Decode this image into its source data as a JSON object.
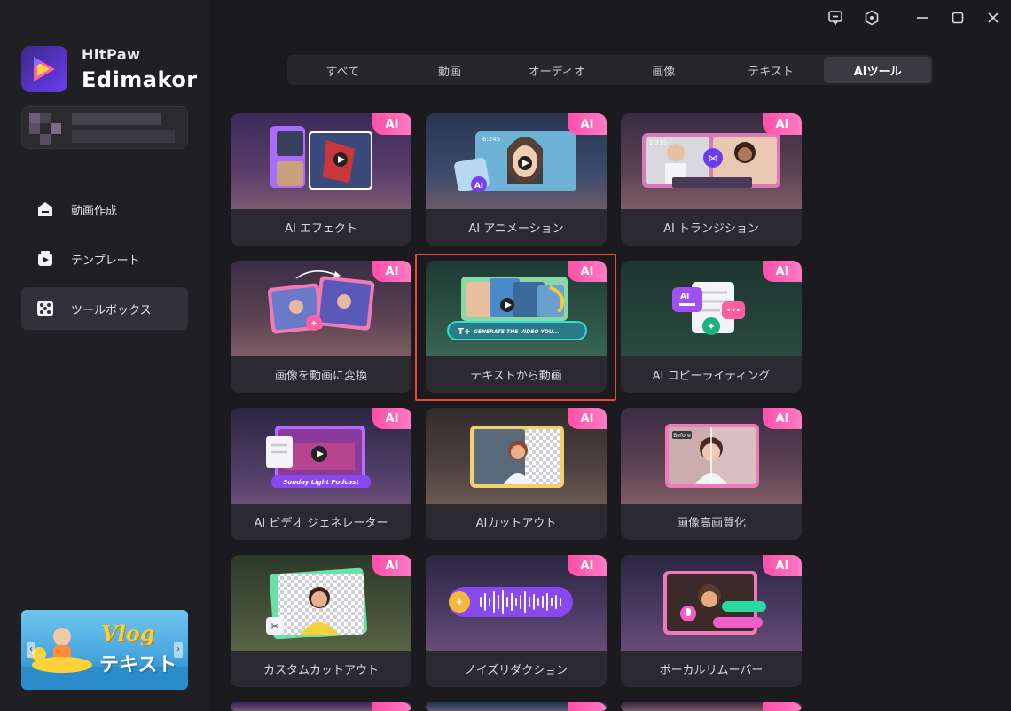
{
  "brand": {
    "line1": "HitPaw",
    "line2": "Edimakor"
  },
  "nav": [
    {
      "label": "動画作成",
      "icon": "home-icon",
      "active": false
    },
    {
      "label": "テンプレート",
      "icon": "template-icon",
      "active": false
    },
    {
      "label": "ツールボックス",
      "icon": "toolbox-icon",
      "active": true
    }
  ],
  "promo": {
    "word1": "Vlog",
    "word2": "テキスト"
  },
  "tabs": [
    {
      "label": "すべて",
      "active": false
    },
    {
      "label": "動画",
      "active": false
    },
    {
      "label": "オーディオ",
      "active": false
    },
    {
      "label": "画像",
      "active": false
    },
    {
      "label": "テキスト",
      "active": false
    },
    {
      "label": "AIツール",
      "active": true
    }
  ],
  "badge_label": "AI",
  "cards": [
    {
      "label": "AI エフェクト",
      "icon": "ai-effect-thumbnail"
    },
    {
      "label": "AI アニメーション",
      "icon": "ai-animation-thumbnail",
      "overlay": "6:24S"
    },
    {
      "label": "AI トランジション",
      "icon": "ai-transition-thumbnail",
      "overlay": "2:21S"
    },
    {
      "label": "画像を動画に変換",
      "icon": "image-to-video-thumbnail"
    },
    {
      "label": "テキストから動画",
      "icon": "text-to-video-thumbnail",
      "overlay": "GENERATE THE VIDEO YOU...",
      "highlighted": true
    },
    {
      "label": "AI コピーライティング",
      "icon": "copywriting-thumbnail"
    },
    {
      "label": "AI ビデオ ジェネレーター",
      "icon": "video-generator-thumbnail",
      "overlay": "Sunday Light Podcast"
    },
    {
      "label": "AIカットアウト",
      "icon": "ai-cutout-thumbnail"
    },
    {
      "label": "画像高画質化",
      "icon": "image-enhance-thumbnail",
      "overlay": "Before"
    },
    {
      "label": "カスタムカットアウト",
      "icon": "custom-cutout-thumbnail"
    },
    {
      "label": "ノイズリダクション",
      "icon": "noise-reduction-thumbnail"
    },
    {
      "label": "ボーカルリムーバー",
      "icon": "vocal-remover-thumbnail"
    }
  ],
  "colors": {
    "accent": "#6a3cf0",
    "badge": "#ff4fa8",
    "highlight": "#e8473c",
    "background": "#1b1b1f",
    "sidebar": "#202024"
  }
}
